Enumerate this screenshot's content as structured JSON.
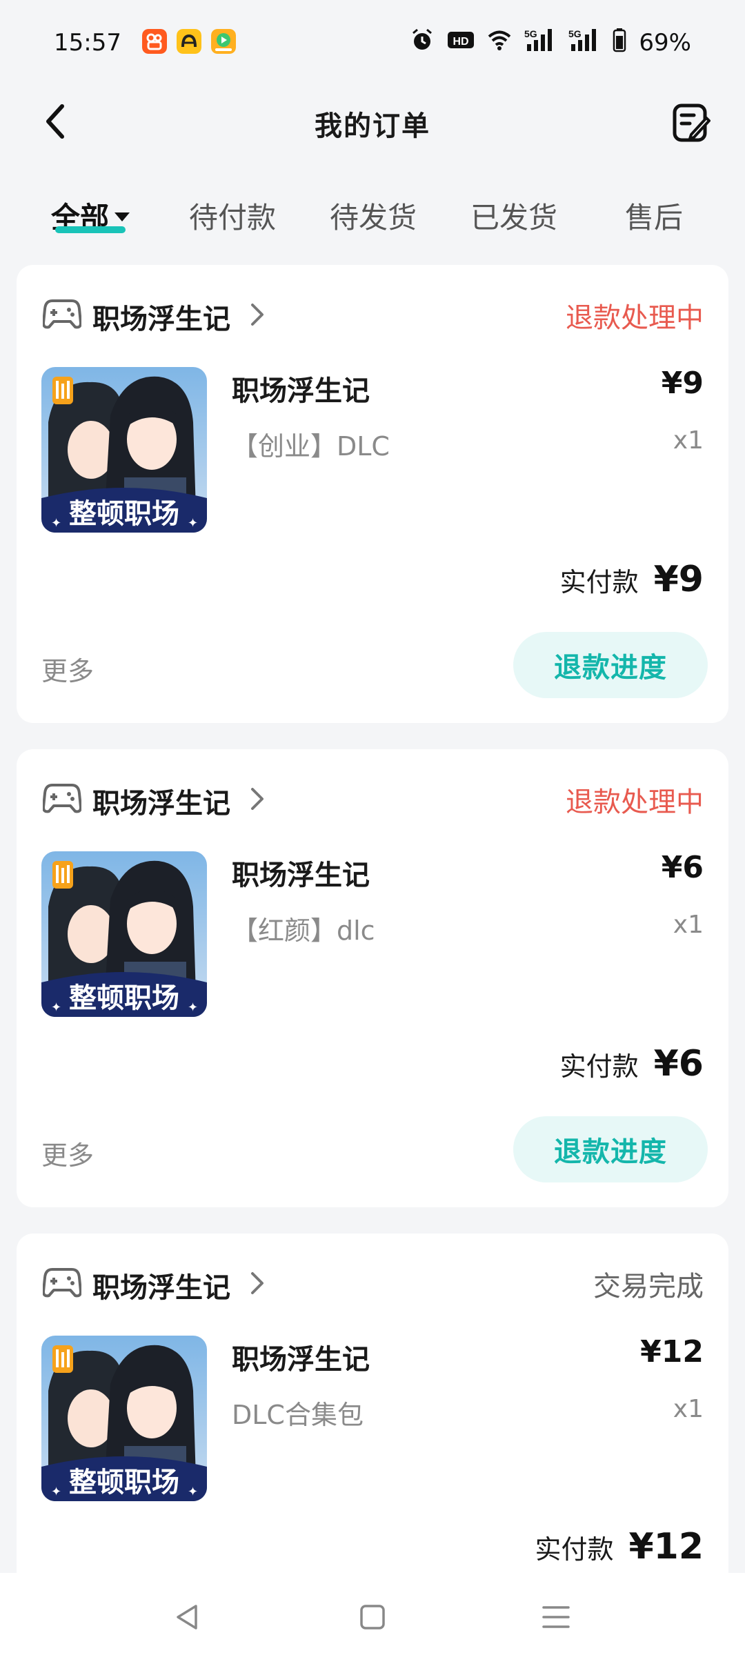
{
  "status_bar": {
    "time": "15:57",
    "battery": "69%",
    "icons": [
      "kuaishou-app-icon",
      "yellow-app-icon",
      "video-app-icon",
      "alarm-icon",
      "hd-icon",
      "wifi-icon",
      "signal-5g-icon",
      "signal-5g-icon",
      "battery-icon"
    ]
  },
  "header": {
    "title": "我的订单",
    "back_icon": "back-arrow-icon",
    "edit_icon": "edit-note-icon"
  },
  "tabs": [
    {
      "label": "全部",
      "active": true
    },
    {
      "label": "待付款",
      "active": false
    },
    {
      "label": "待发货",
      "active": false
    },
    {
      "label": "已发货",
      "active": false
    },
    {
      "label": "售后",
      "active": false
    }
  ],
  "colors": {
    "accent": "#19c3b8",
    "refund_status": "#e85a4f",
    "done_status": "#666666",
    "button_bg": "#e7f8f7",
    "button_text": "#14b6ab"
  },
  "orders": [
    {
      "shop": "职场浮生记",
      "status": "退款处理中",
      "status_color": "#e85a4f",
      "item_title": "职场浮生记",
      "sku": "【创业】DLC",
      "price": "¥9",
      "qty": "x1",
      "paid_label": "实付款",
      "paid_value": "¥9",
      "more": "更多",
      "action": "退款进度",
      "thumb_text": "整顿职场"
    },
    {
      "shop": "职场浮生记",
      "status": "退款处理中",
      "status_color": "#e85a4f",
      "item_title": "职场浮生记",
      "sku": "【红颜】dlc",
      "price": "¥6",
      "qty": "x1",
      "paid_label": "实付款",
      "paid_value": "¥6",
      "more": "更多",
      "action": "退款进度",
      "thumb_text": "整顿职场"
    },
    {
      "shop": "职场浮生记",
      "status": "交易完成",
      "status_color": "#666666",
      "item_title": "职场浮生记",
      "sku": "DLC合集包",
      "price": "¥12",
      "qty": "x1",
      "paid_label": "实付款",
      "paid_value": "¥12",
      "thumb_text": "整顿职场"
    }
  ],
  "nav": {
    "icons": [
      "back-triangle-icon",
      "home-square-icon",
      "menu-lines-icon"
    ]
  }
}
